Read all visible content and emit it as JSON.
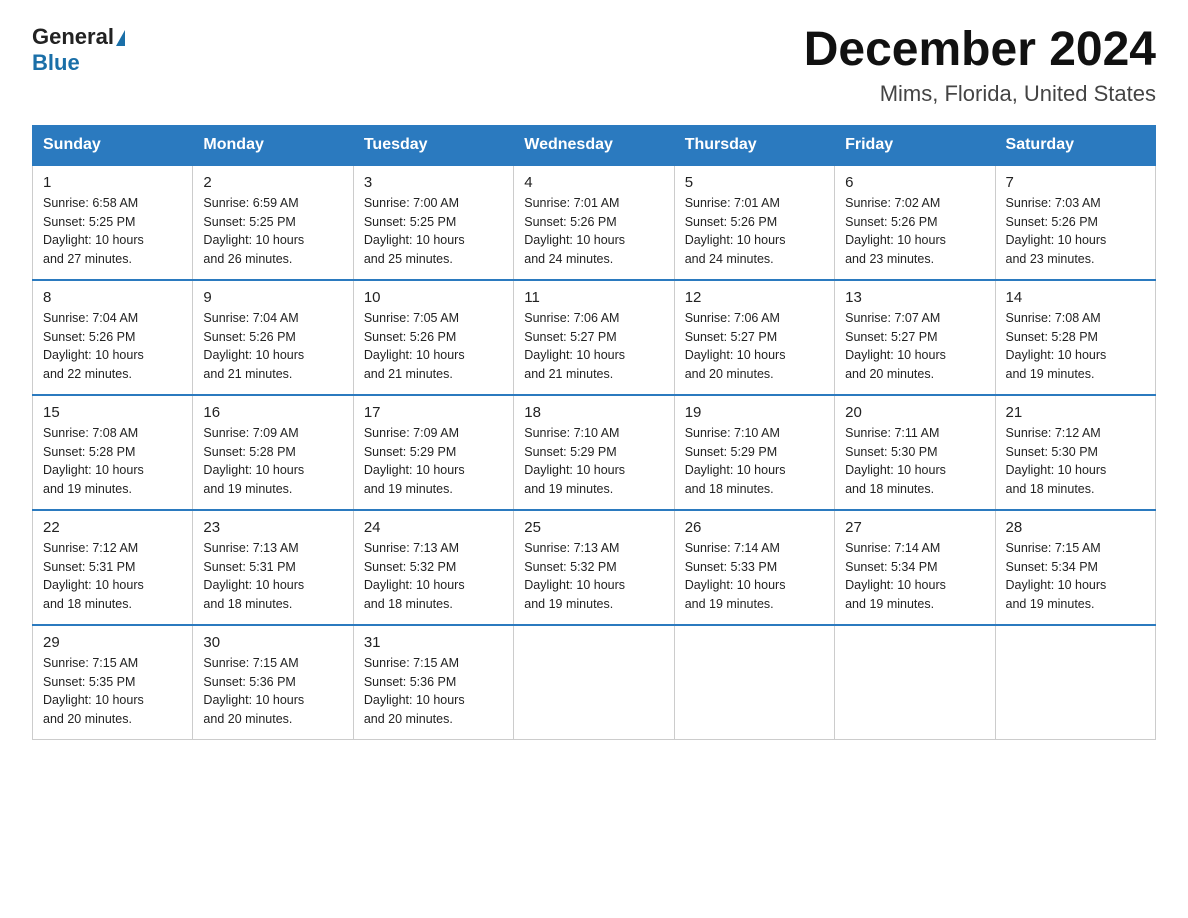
{
  "logo": {
    "general": "General",
    "blue": "Blue"
  },
  "title": "December 2024",
  "subtitle": "Mims, Florida, United States",
  "days_header": [
    "Sunday",
    "Monday",
    "Tuesday",
    "Wednesday",
    "Thursday",
    "Friday",
    "Saturday"
  ],
  "weeks": [
    [
      {
        "num": "1",
        "sunrise": "6:58 AM",
        "sunset": "5:25 PM",
        "daylight": "10 hours and 27 minutes."
      },
      {
        "num": "2",
        "sunrise": "6:59 AM",
        "sunset": "5:25 PM",
        "daylight": "10 hours and 26 minutes."
      },
      {
        "num": "3",
        "sunrise": "7:00 AM",
        "sunset": "5:25 PM",
        "daylight": "10 hours and 25 minutes."
      },
      {
        "num": "4",
        "sunrise": "7:01 AM",
        "sunset": "5:26 PM",
        "daylight": "10 hours and 24 minutes."
      },
      {
        "num": "5",
        "sunrise": "7:01 AM",
        "sunset": "5:26 PM",
        "daylight": "10 hours and 24 minutes."
      },
      {
        "num": "6",
        "sunrise": "7:02 AM",
        "sunset": "5:26 PM",
        "daylight": "10 hours and 23 minutes."
      },
      {
        "num": "7",
        "sunrise": "7:03 AM",
        "sunset": "5:26 PM",
        "daylight": "10 hours and 23 minutes."
      }
    ],
    [
      {
        "num": "8",
        "sunrise": "7:04 AM",
        "sunset": "5:26 PM",
        "daylight": "10 hours and 22 minutes."
      },
      {
        "num": "9",
        "sunrise": "7:04 AM",
        "sunset": "5:26 PM",
        "daylight": "10 hours and 21 minutes."
      },
      {
        "num": "10",
        "sunrise": "7:05 AM",
        "sunset": "5:26 PM",
        "daylight": "10 hours and 21 minutes."
      },
      {
        "num": "11",
        "sunrise": "7:06 AM",
        "sunset": "5:27 PM",
        "daylight": "10 hours and 21 minutes."
      },
      {
        "num": "12",
        "sunrise": "7:06 AM",
        "sunset": "5:27 PM",
        "daylight": "10 hours and 20 minutes."
      },
      {
        "num": "13",
        "sunrise": "7:07 AM",
        "sunset": "5:27 PM",
        "daylight": "10 hours and 20 minutes."
      },
      {
        "num": "14",
        "sunrise": "7:08 AM",
        "sunset": "5:28 PM",
        "daylight": "10 hours and 19 minutes."
      }
    ],
    [
      {
        "num": "15",
        "sunrise": "7:08 AM",
        "sunset": "5:28 PM",
        "daylight": "10 hours and 19 minutes."
      },
      {
        "num": "16",
        "sunrise": "7:09 AM",
        "sunset": "5:28 PM",
        "daylight": "10 hours and 19 minutes."
      },
      {
        "num": "17",
        "sunrise": "7:09 AM",
        "sunset": "5:29 PM",
        "daylight": "10 hours and 19 minutes."
      },
      {
        "num": "18",
        "sunrise": "7:10 AM",
        "sunset": "5:29 PM",
        "daylight": "10 hours and 19 minutes."
      },
      {
        "num": "19",
        "sunrise": "7:10 AM",
        "sunset": "5:29 PM",
        "daylight": "10 hours and 18 minutes."
      },
      {
        "num": "20",
        "sunrise": "7:11 AM",
        "sunset": "5:30 PM",
        "daylight": "10 hours and 18 minutes."
      },
      {
        "num": "21",
        "sunrise": "7:12 AM",
        "sunset": "5:30 PM",
        "daylight": "10 hours and 18 minutes."
      }
    ],
    [
      {
        "num": "22",
        "sunrise": "7:12 AM",
        "sunset": "5:31 PM",
        "daylight": "10 hours and 18 minutes."
      },
      {
        "num": "23",
        "sunrise": "7:13 AM",
        "sunset": "5:31 PM",
        "daylight": "10 hours and 18 minutes."
      },
      {
        "num": "24",
        "sunrise": "7:13 AM",
        "sunset": "5:32 PM",
        "daylight": "10 hours and 18 minutes."
      },
      {
        "num": "25",
        "sunrise": "7:13 AM",
        "sunset": "5:32 PM",
        "daylight": "10 hours and 19 minutes."
      },
      {
        "num": "26",
        "sunrise": "7:14 AM",
        "sunset": "5:33 PM",
        "daylight": "10 hours and 19 minutes."
      },
      {
        "num": "27",
        "sunrise": "7:14 AM",
        "sunset": "5:34 PM",
        "daylight": "10 hours and 19 minutes."
      },
      {
        "num": "28",
        "sunrise": "7:15 AM",
        "sunset": "5:34 PM",
        "daylight": "10 hours and 19 minutes."
      }
    ],
    [
      {
        "num": "29",
        "sunrise": "7:15 AM",
        "sunset": "5:35 PM",
        "daylight": "10 hours and 20 minutes."
      },
      {
        "num": "30",
        "sunrise": "7:15 AM",
        "sunset": "5:36 PM",
        "daylight": "10 hours and 20 minutes."
      },
      {
        "num": "31",
        "sunrise": "7:15 AM",
        "sunset": "5:36 PM",
        "daylight": "10 hours and 20 minutes."
      },
      null,
      null,
      null,
      null
    ]
  ],
  "labels": {
    "sunrise": "Sunrise:",
    "sunset": "Sunset:",
    "daylight": "Daylight:"
  }
}
